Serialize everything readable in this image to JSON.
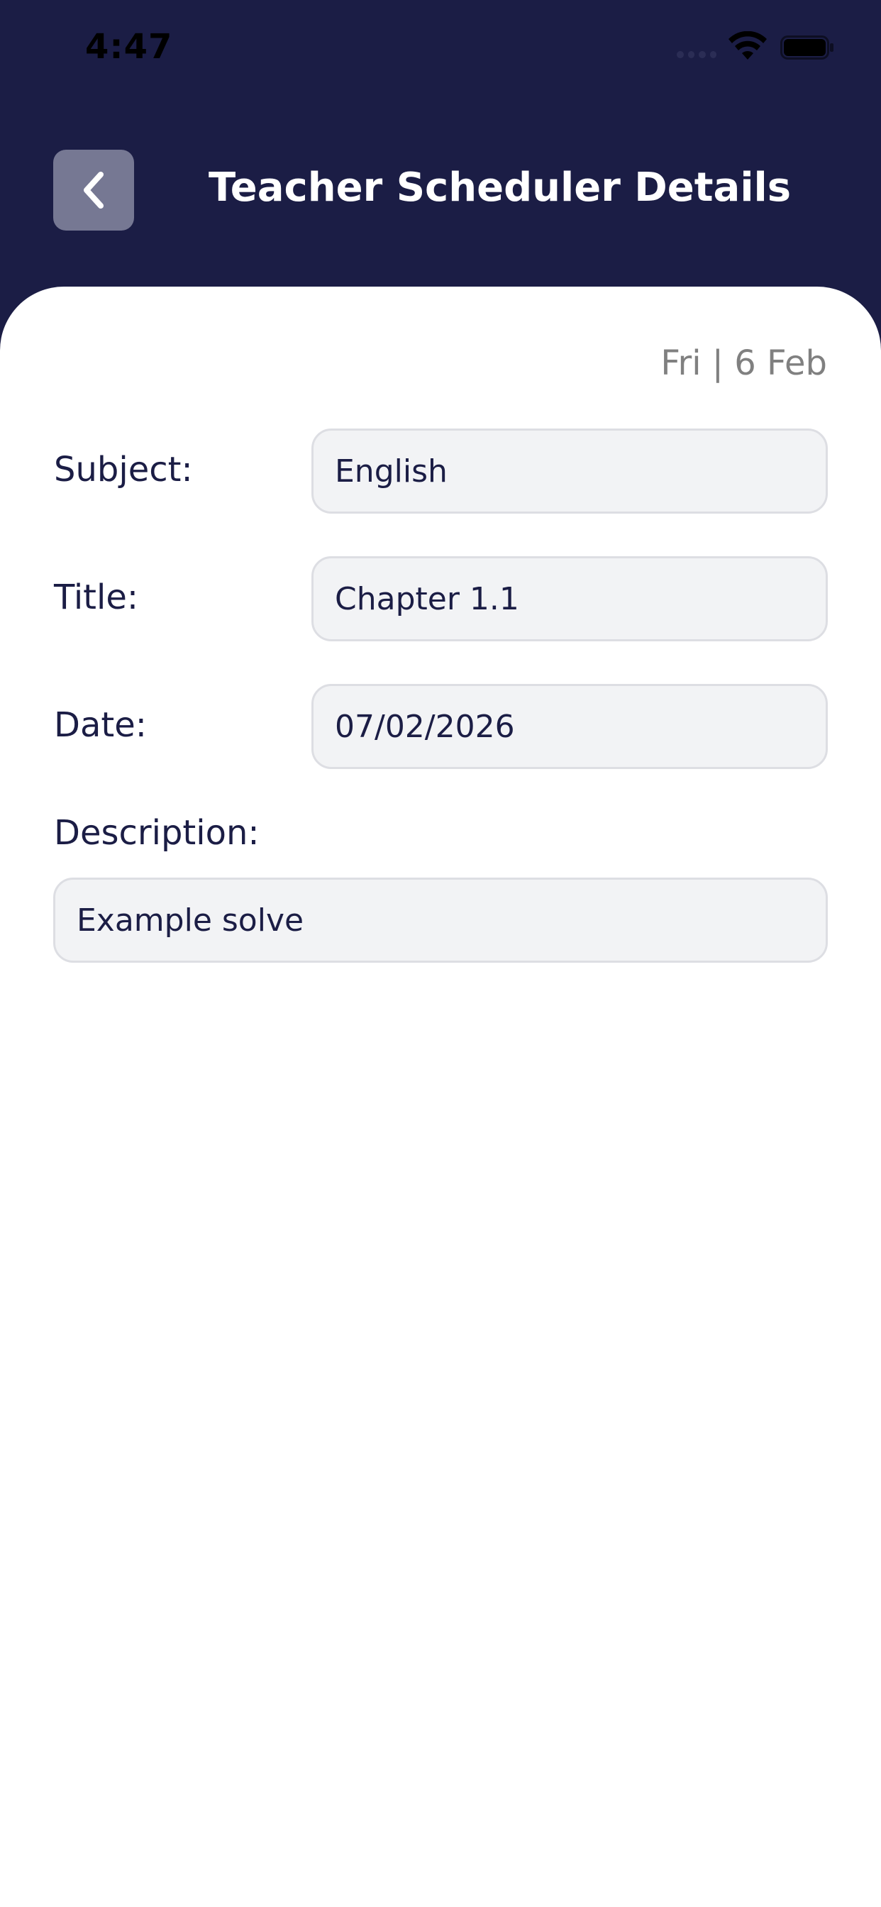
{
  "status_bar": {
    "time": "4:47"
  },
  "header": {
    "title": "Teacher Scheduler Details",
    "back_icon": "chevron-left-icon",
    "background_color": "#1b1d45"
  },
  "content": {
    "date_label": "Fri | 6 Feb",
    "fields": {
      "subject": {
        "label": "Subject:",
        "value": "English"
      },
      "title": {
        "label": "Title:",
        "value": "Chapter 1.1"
      },
      "date": {
        "label": "Date:",
        "value": "07/02/2026"
      },
      "description": {
        "label": "Description:",
        "value": "Example solve"
      }
    }
  },
  "colors": {
    "primary_navy": "#1b1d45",
    "back_button": "#767893",
    "field_background": "#f2f3f5",
    "field_border": "#dddee3",
    "muted_text": "#808080"
  }
}
